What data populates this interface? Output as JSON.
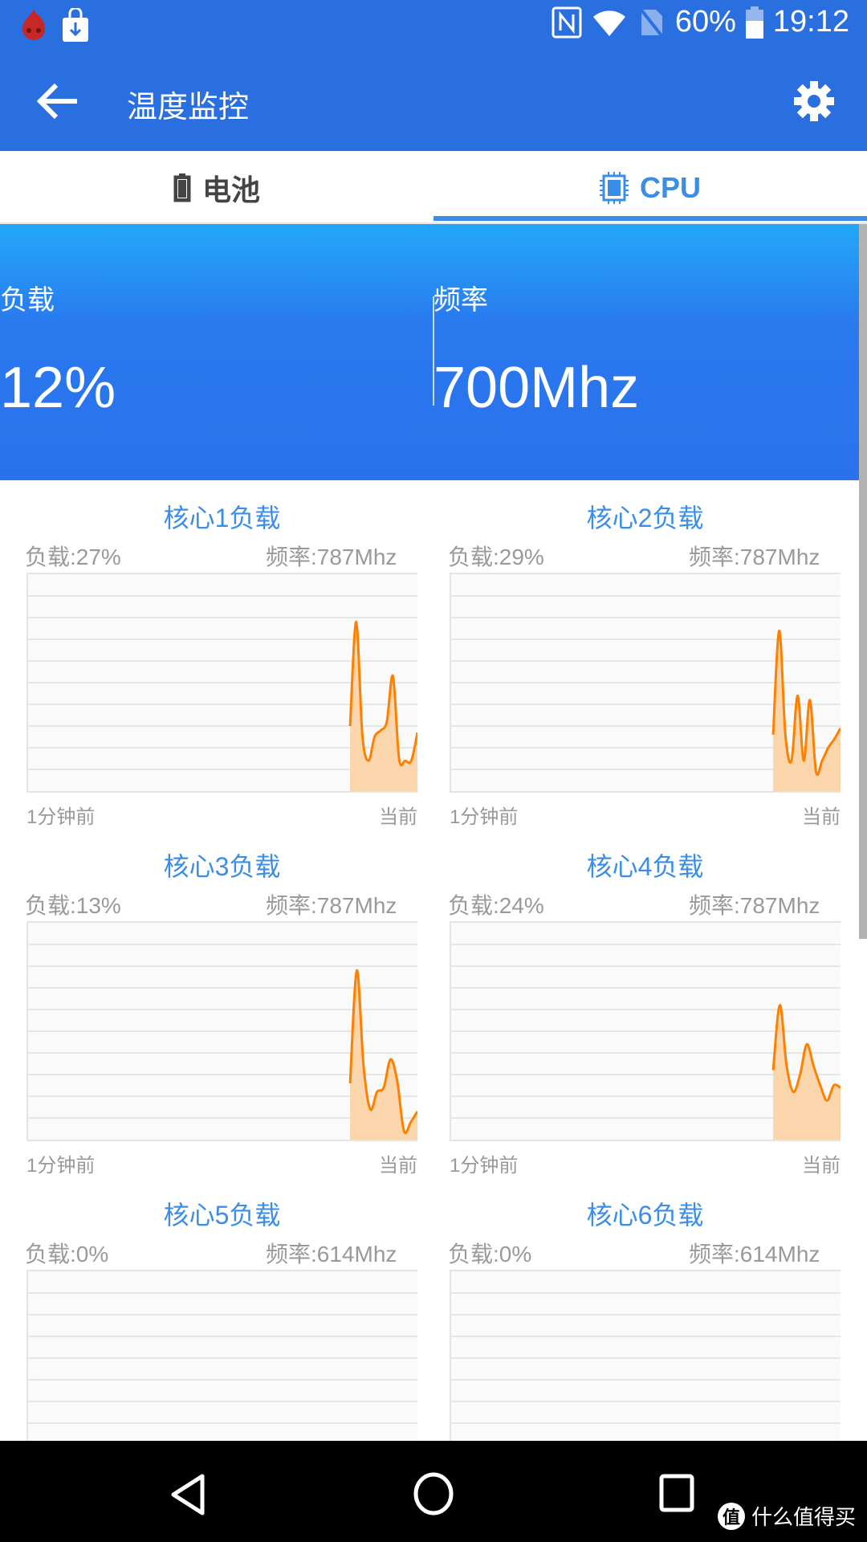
{
  "status_bar": {
    "battery": "60%",
    "time": "19:12",
    "icons": [
      "antutu-app-icon",
      "download-store-icon",
      "nfc-icon",
      "wifi-icon",
      "no-sim-icon",
      "battery-icon"
    ]
  },
  "toolbar": {
    "title": "温度监控",
    "back_icon": "arrow-left-icon",
    "settings_icon": "gear-icon"
  },
  "tabs": [
    {
      "label": "电池",
      "icon": "battery-icon",
      "active": false
    },
    {
      "label": "CPU",
      "icon": "cpu-chip-icon",
      "active": true
    }
  ],
  "summary": {
    "load_label": "负载",
    "load_value": "12%",
    "freq_label": "频率",
    "freq_value": "700Mhz"
  },
  "colors": {
    "primary": "#2a6fe0",
    "accent": "#3a8ee8",
    "line": "#ff8000",
    "fill": "#fbd3a6"
  },
  "cores": [
    {
      "title": "核心1负载",
      "load": "负载:27%",
      "freq": "频率:787Mhz",
      "x_start": "1分钟前",
      "x_end": "当前"
    },
    {
      "title": "核心2负载",
      "load": "负载:29%",
      "freq": "频率:787Mhz",
      "x_start": "1分钟前",
      "x_end": "当前"
    },
    {
      "title": "核心3负载",
      "load": "负载:13%",
      "freq": "频率:787Mhz",
      "x_start": "1分钟前",
      "x_end": "当前"
    },
    {
      "title": "核心4负载",
      "load": "负载:24%",
      "freq": "频率:787Mhz",
      "x_start": "1分钟前",
      "x_end": "当前"
    },
    {
      "title": "核心5负载",
      "load": "负载:0%",
      "freq": "频率:614Mhz",
      "x_start": "",
      "x_end": ""
    },
    {
      "title": "核心6负载",
      "load": "负载:0%",
      "freq": "频率:614Mhz",
      "x_start": "",
      "x_end": ""
    }
  ],
  "chart_data": [
    {
      "type": "area",
      "title": "核心1负载",
      "ylim": [
        0,
        100
      ],
      "grid": true,
      "xlabel_start": "1分钟前",
      "xlabel_end": "当前",
      "values": [
        30,
        78,
        26,
        14,
        25,
        28,
        32,
        53,
        15,
        14,
        14,
        27
      ]
    },
    {
      "type": "area",
      "title": "核心2负载",
      "ylim": [
        0,
        100
      ],
      "grid": true,
      "xlabel_start": "1分钟前",
      "xlabel_end": "当前",
      "values": [
        26,
        74,
        26,
        14,
        44,
        14,
        42,
        9,
        14,
        20,
        24,
        29
      ]
    },
    {
      "type": "area",
      "title": "核心3负载",
      "ylim": [
        0,
        100
      ],
      "grid": true,
      "xlabel_start": "1分钟前",
      "xlabel_end": "当前",
      "values": [
        26,
        78,
        34,
        14,
        22,
        24,
        37,
        27,
        4,
        8,
        13
      ]
    },
    {
      "type": "area",
      "title": "核心4负载",
      "ylim": [
        0,
        100
      ],
      "grid": true,
      "xlabel_start": "1分钟前",
      "xlabel_end": "当前",
      "values": [
        32,
        62,
        34,
        22,
        30,
        44,
        34,
        25,
        18,
        25,
        24
      ]
    },
    {
      "type": "area",
      "title": "核心5负载",
      "ylim": [
        0,
        100
      ],
      "grid": true,
      "values": []
    },
    {
      "type": "area",
      "title": "核心6负载",
      "ylim": [
        0,
        100
      ],
      "grid": true,
      "values": []
    }
  ],
  "nav_bar": {
    "back": "triangle-back-icon",
    "home": "circle-home-icon",
    "recents": "square-recents-icon"
  },
  "watermark": {
    "badge": "值",
    "text": "什么值得买"
  }
}
